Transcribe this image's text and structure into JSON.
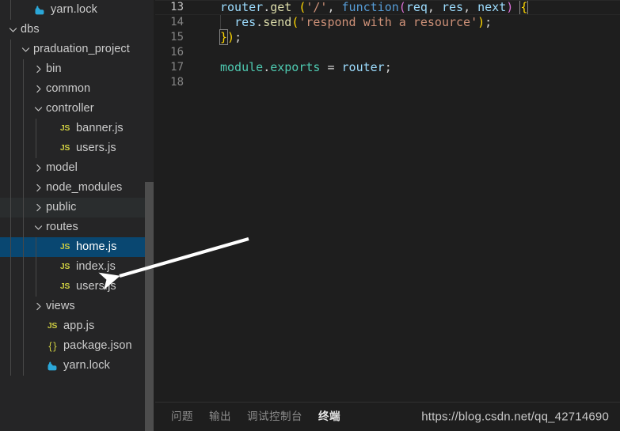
{
  "sidebar": {
    "scrollbar_color": "#4d4d4d",
    "selected_color": "#094771",
    "hover_color": "#2a2d2e",
    "items": [
      {
        "label": "yarn.lock",
        "icon": "yarn-icon",
        "indent": 1,
        "twisty": "none",
        "state": "normal"
      },
      {
        "label": "dbs",
        "icon": "none",
        "indent": 0,
        "twisty": "expanded",
        "state": "normal"
      },
      {
        "label": "praduation_project",
        "icon": "none",
        "indent": 1,
        "twisty": "expanded",
        "state": "normal"
      },
      {
        "label": "bin",
        "icon": "none",
        "indent": 2,
        "twisty": "collapsed",
        "state": "normal"
      },
      {
        "label": "common",
        "icon": "none",
        "indent": 2,
        "twisty": "collapsed",
        "state": "normal"
      },
      {
        "label": "controller",
        "icon": "none",
        "indent": 2,
        "twisty": "expanded",
        "state": "normal"
      },
      {
        "label": "banner.js",
        "icon": "js-icon",
        "indent": 3,
        "twisty": "none",
        "state": "normal"
      },
      {
        "label": "users.js",
        "icon": "js-icon",
        "indent": 3,
        "twisty": "none",
        "state": "normal"
      },
      {
        "label": "model",
        "icon": "none",
        "indent": 2,
        "twisty": "collapsed",
        "state": "normal"
      },
      {
        "label": "node_modules",
        "icon": "none",
        "indent": 2,
        "twisty": "collapsed",
        "state": "normal"
      },
      {
        "label": "public",
        "icon": "none",
        "indent": 2,
        "twisty": "collapsed",
        "state": "hover"
      },
      {
        "label": "routes",
        "icon": "none",
        "indent": 2,
        "twisty": "expanded",
        "state": "normal"
      },
      {
        "label": "home.js",
        "icon": "js-icon",
        "indent": 3,
        "twisty": "none",
        "state": "selected"
      },
      {
        "label": "index.js",
        "icon": "js-icon",
        "indent": 3,
        "twisty": "none",
        "state": "normal"
      },
      {
        "label": "users.js",
        "icon": "js-icon",
        "indent": 3,
        "twisty": "none",
        "state": "normal"
      },
      {
        "label": "views",
        "icon": "none",
        "indent": 2,
        "twisty": "collapsed",
        "state": "normal"
      },
      {
        "label": "app.js",
        "icon": "js-icon",
        "indent": 2,
        "twisty": "none",
        "state": "normal"
      },
      {
        "label": "package.json",
        "icon": "json-icon",
        "indent": 2,
        "twisty": "none",
        "state": "normal"
      },
      {
        "label": "yarn.lock",
        "icon": "yarn-icon",
        "indent": 2,
        "twisty": "none",
        "state": "normal"
      }
    ]
  },
  "editor": {
    "lines": [
      {
        "num": "13",
        "active": true,
        "indent_guide": false
      },
      {
        "num": "14",
        "active": false,
        "indent_guide": true
      },
      {
        "num": "15",
        "active": false,
        "indent_guide": false
      },
      {
        "num": "16",
        "active": false,
        "indent_guide": false
      },
      {
        "num": "17",
        "active": false,
        "indent_guide": false
      },
      {
        "num": "18",
        "active": false,
        "indent_guide": false
      }
    ],
    "line13": {
      "router": "router",
      "dot1": ".",
      "get": "get",
      "space": " ",
      "paren_open": "(",
      "str_slash": "'/'",
      "comma1": ", ",
      "function": "function",
      "paren2_open": "(",
      "req": "req",
      "comma2": ", ",
      "res": "res",
      "comma3": ", ",
      "next": "next",
      "paren2_close": ")",
      "space2": " ",
      "brace_open": "{"
    },
    "line14": {
      "indent": "  ",
      "res": "res",
      "dot": ".",
      "send": "send",
      "paren_open": "(",
      "string": "'respond with a resource'",
      "paren_close": ")",
      "semi": ";"
    },
    "line15": {
      "brace_close": "}",
      "paren_close": ")",
      "semi": ";"
    },
    "line17": {
      "module": "module",
      "dot": ".",
      "exports": "exports",
      "equals": " = ",
      "router": "router",
      "semi": ";"
    }
  },
  "panel": {
    "tabs": [
      {
        "label": "问题",
        "name": "problems",
        "active": false
      },
      {
        "label": "输出",
        "name": "output",
        "active": false
      },
      {
        "label": "调试控制台",
        "name": "debug-console",
        "active": false
      },
      {
        "label": "终端",
        "name": "terminal",
        "active": true
      }
    ],
    "watermark": "https://blog.csdn.net/qq_42714690"
  },
  "annotation": {
    "arrow_color": "#ffffff",
    "points_to": "home.js"
  }
}
